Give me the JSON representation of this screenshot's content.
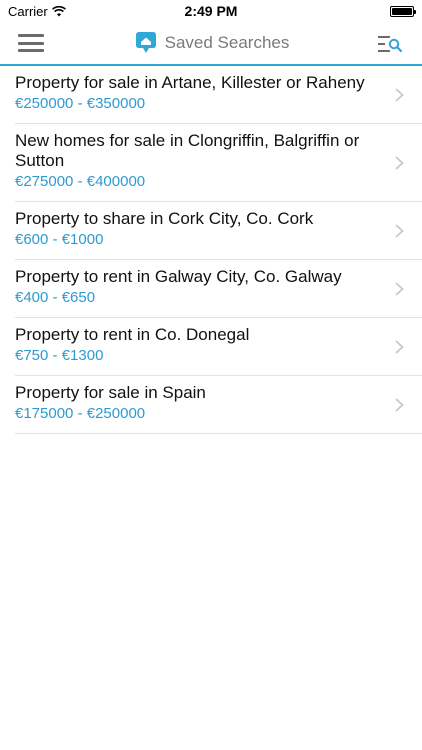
{
  "status_bar": {
    "carrier": "Carrier",
    "time": "2:49 PM"
  },
  "nav": {
    "title": "Saved Searches"
  },
  "searches": [
    {
      "title": "Property for sale in Artane, Killester or Raheny",
      "price": "€250000 - €350000"
    },
    {
      "title": "New homes for sale in Clongriffin, Balgriffin or Sutton",
      "price": "€275000 - €400000"
    },
    {
      "title": "Property to share in Cork City, Co. Cork",
      "price": "€600 - €1000"
    },
    {
      "title": "Property to rent in Galway City, Co. Galway",
      "price": "€400 - €650"
    },
    {
      "title": "Property to rent in Co. Donegal",
      "price": "€750 - €1300"
    },
    {
      "title": "Property for sale in Spain",
      "price": "€175000 - €250000"
    }
  ],
  "colors": {
    "accent": "#2fa7d8",
    "price": "#2c9bd0"
  }
}
